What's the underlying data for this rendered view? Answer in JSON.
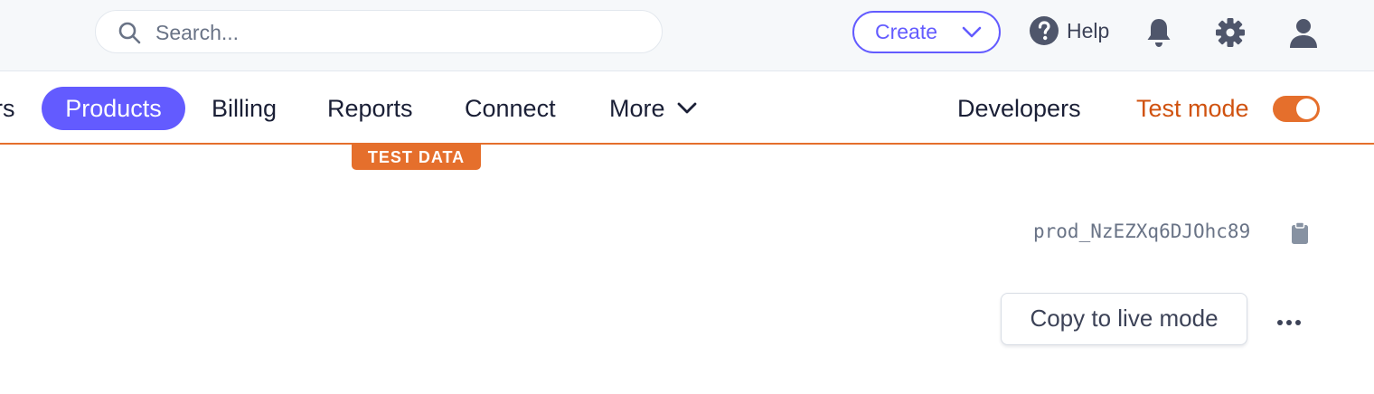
{
  "search": {
    "placeholder": "Search..."
  },
  "header": {
    "create_label": "Create",
    "help_label": "Help"
  },
  "nav": {
    "partial_label": "rs",
    "items": [
      "Products",
      "Billing",
      "Reports",
      "Connect",
      "More"
    ],
    "developers_label": "Developers",
    "test_mode_label": "Test mode",
    "test_mode_on": true
  },
  "badge": {
    "label": "TEST DATA"
  },
  "product": {
    "id": "prod_NzEZXq6DJOhc89",
    "copy_live_label": "Copy to live mode"
  },
  "colors": {
    "brand": "#635bff",
    "test_mode": "#e56f2c",
    "test_mode_text": "#d0520f",
    "muted_text": "#697386"
  },
  "icons": [
    "search-icon",
    "chevron-down-icon",
    "help-icon",
    "bell-icon",
    "gear-icon",
    "user-icon",
    "clipboard-icon",
    "more-horizontal-icon"
  ]
}
